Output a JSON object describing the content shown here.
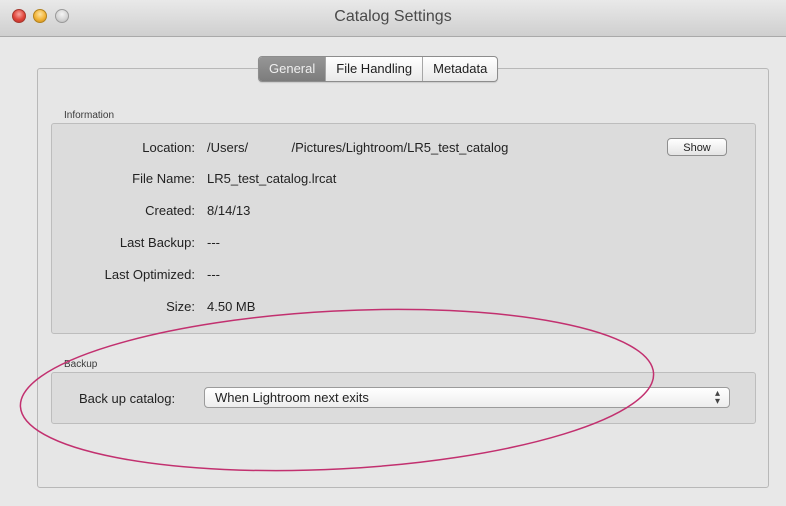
{
  "window": {
    "title": "Catalog Settings"
  },
  "tabs": [
    {
      "label": "General",
      "active": true
    },
    {
      "label": "File Handling",
      "active": false
    },
    {
      "label": "Metadata",
      "active": false
    }
  ],
  "information": {
    "section_label": "Information",
    "rows": [
      {
        "label": "Location:",
        "value": "/Users/            /Pictures/Lightroom/LR5_test_catalog"
      },
      {
        "label": "File Name:",
        "value": "LR5_test_catalog.lrcat"
      },
      {
        "label": "Created:",
        "value": "8/14/13"
      },
      {
        "label": "Last Backup:",
        "value": "---"
      },
      {
        "label": "Last Optimized:",
        "value": "---"
      },
      {
        "label": "Size:",
        "value": "4.50 MB"
      }
    ],
    "show_button": "Show"
  },
  "backup": {
    "section_label": "Backup",
    "label": "Back up catalog:",
    "selected": "When Lightroom next exits"
  },
  "colors": {
    "annotation": "#c2306f",
    "active_tab": "#8a8a8a"
  }
}
